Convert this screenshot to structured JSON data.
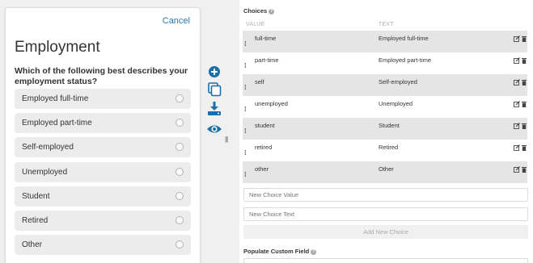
{
  "preview": {
    "cancel_label": "Cancel",
    "title": "Employment",
    "question": "Which of the following best describes your employment status?",
    "options": [
      "Employed full-time",
      "Employed part-time",
      "Self-employed",
      "Unemployed",
      "Student",
      "Retired",
      "Other"
    ]
  },
  "tools": [
    "add-icon",
    "copy-icon",
    "download-icon",
    "preview-eye-icon"
  ],
  "colors": {
    "accent": "#1a6fa8",
    "link": "#2a7ab0",
    "row_shade": "#e5e5e5"
  },
  "splitter": "|||",
  "choices": {
    "label": "Choices",
    "help": "?",
    "value_header": "VALUE",
    "text_header": "TEXT",
    "rows": [
      {
        "value": "full-time",
        "text": "Employed full-time"
      },
      {
        "value": "part-time",
        "text": "Employed part-time"
      },
      {
        "value": "self",
        "text": "Self-employed"
      },
      {
        "value": "unemployed",
        "text": "Unemployed"
      },
      {
        "value": "student",
        "text": "Student"
      },
      {
        "value": "retired",
        "text": "Retired"
      },
      {
        "value": "other",
        "text": "Other"
      }
    ],
    "new_value_placeholder": "New Choice Value",
    "new_text_placeholder": "New Choice Text",
    "add_button": "Add New Choice"
  },
  "custom_field": {
    "label": "Populate Custom Field",
    "help": "?"
  }
}
